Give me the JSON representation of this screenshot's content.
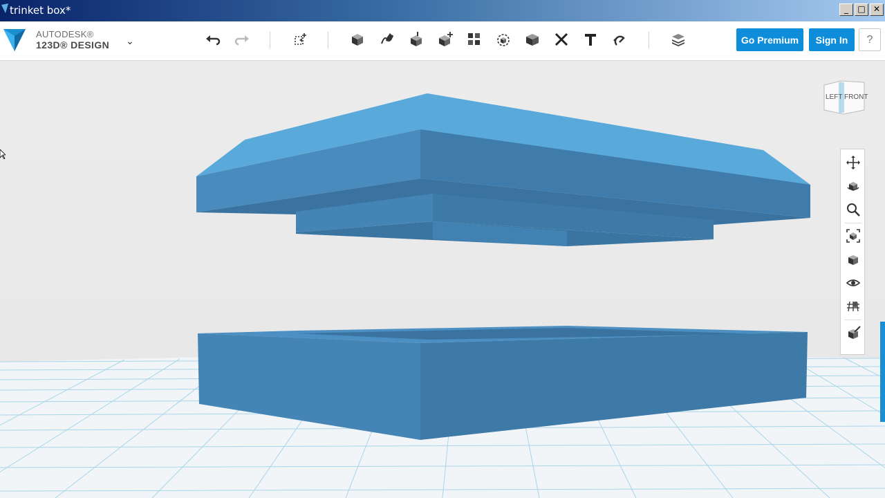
{
  "window": {
    "title": "trinket box*",
    "controls": {
      "minimize": "_",
      "maximize": "□",
      "close": "✕"
    }
  },
  "brand": {
    "line1": "AUTODESK®",
    "line2": "123D® DESIGN",
    "menu_caret": "⌄",
    "logo_icon": "123d-logo-icon"
  },
  "toolbar": {
    "undo_icon": "undo-icon",
    "redo_icon": "redo-icon",
    "tools": [
      "transform-icon",
      "primitives-icon",
      "sketch-icon",
      "construct-icon",
      "modify-icon",
      "pattern-icon",
      "grouping-icon",
      "combine-icon",
      "measure-icon",
      "text-icon",
      "snap-icon",
      "material-icon"
    ],
    "go_premium_label": "Go Premium",
    "sign_in_label": "Sign In",
    "help_label": "?"
  },
  "viewcube": {
    "left_label": "LEFT",
    "front_label": "FRONT"
  },
  "navbar": {
    "tools": [
      "pan-icon",
      "orbit-icon",
      "zoom-icon",
      "fit-icon",
      "view-options-icon",
      "visibility-icon",
      "grid-toggle-icon",
      "material-display-icon"
    ]
  },
  "colors": {
    "accent": "#0e8ddb",
    "model_top": "#5aa9db",
    "model_front": "#4080b0",
    "model_side": "#3a78a6",
    "grid": "#a8d5ea"
  }
}
